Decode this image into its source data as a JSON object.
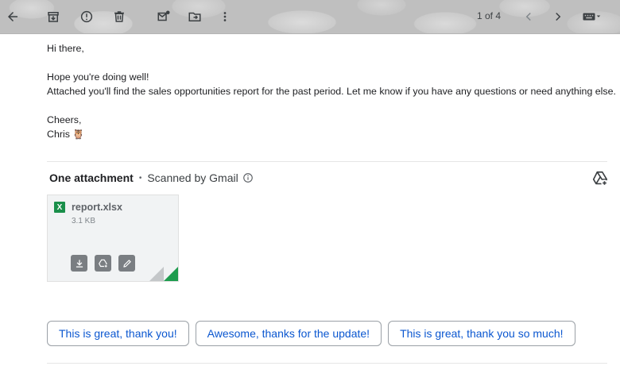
{
  "toolbar": {
    "icons": [
      "back-arrow-icon",
      "archive-icon",
      "report-spam-icon",
      "delete-icon",
      "mark-unread-icon",
      "move-to-icon",
      "more-vert-icon",
      "chevron-left-icon",
      "chevron-right-icon",
      "keyboard-icon"
    ],
    "pager": "1 of 4"
  },
  "message": {
    "greeting": "Hi there,",
    "line1": "Hope you're doing well!",
    "line2": "Attached you'll find the sales opportunities report for the past period. Let me know if you have any questions or need anything else.",
    "signoff": "Cheers,",
    "signature": "Chris",
    "signature_emoji": "🦉"
  },
  "attachments": {
    "title": "One attachment",
    "separator": "•",
    "scanned": "Scanned by Gmail",
    "items": [
      {
        "icon_letter": "X",
        "name": "report.xlsx",
        "size": "3.1 KB",
        "actions": [
          "download-icon",
          "add-to-drive-icon",
          "edit-icon"
        ]
      }
    ]
  },
  "smart_replies": [
    "This is great, thank you!",
    "Awesome, thanks for the update!",
    "This is great, thank you so much!"
  ],
  "colors": {
    "accent": "#0b57d0",
    "excel_green": "#1a8f4a",
    "toolbar_bg": "#bfbfbf"
  }
}
